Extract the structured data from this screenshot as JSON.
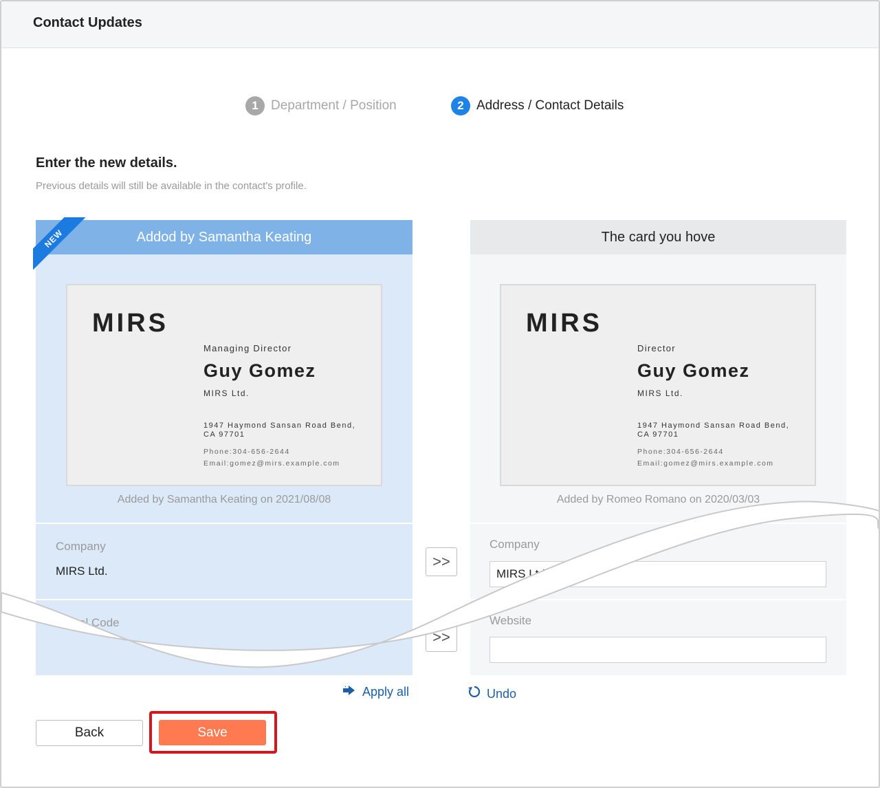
{
  "app": {
    "title": "Contact Updates"
  },
  "steps": [
    {
      "number": "1",
      "label": "Department / Position",
      "state": "done"
    },
    {
      "number": "2",
      "label": "Address / Contact Details",
      "state": "active"
    }
  ],
  "main": {
    "heading": "Enter the new details.",
    "subtext": "Previous details will still be available in the contact's profile."
  },
  "left_panel": {
    "badge": "NEW",
    "header": "Addod by Samantha Keating",
    "card": {
      "logo": "MIRS",
      "title": "Managing Director",
      "name": "Guy Gomez",
      "company": "MIRS Ltd.",
      "address_line1": "1947 Haymond Sansan Road Bend,",
      "address_line2": "CA 97701",
      "phone": "Phone:304-656-2644",
      "email": "Email:gomez@mirs.example.com"
    },
    "added_note": "Added by Samantha Keating on 2021/08/08",
    "fields": [
      {
        "label": "Company",
        "value": "MIRS Ltd."
      },
      {
        "label": "Postal Code",
        "value": ""
      }
    ]
  },
  "right_panel": {
    "header": "The card you hove",
    "card": {
      "logo": "MIRS",
      "title": "Director",
      "name": "Guy Gomez",
      "company": "MIRS Ltd.",
      "address_line1": "1947 Haymond Sansan Road Bend,",
      "address_line2": "CA 97701",
      "phone": "Phone:304-656-2644",
      "email": "Email:gomez@mirs.example.com"
    },
    "added_note": "Added by Romeo Romano on 2020/03/03",
    "fields": [
      {
        "label": "Company",
        "value": "MIRS Ltd."
      },
      {
        "label": "Website",
        "value": ""
      }
    ]
  },
  "transfer": {
    "arrow": ">>"
  },
  "actions": {
    "apply_all": "Apply all",
    "undo": "Undo",
    "back": "Back",
    "save": "Save"
  },
  "colors": {
    "accent_blue": "#1e82e6",
    "link_blue": "#1b5fa8",
    "save_orange": "#ff7a50",
    "highlight_red": "#d6151c",
    "new_panel_bg": "#dbe9f9",
    "new_panel_header": "#7fb2e6"
  },
  "icons": {
    "apply_all": "arrow-right-icon",
    "undo": "undo-icon"
  }
}
